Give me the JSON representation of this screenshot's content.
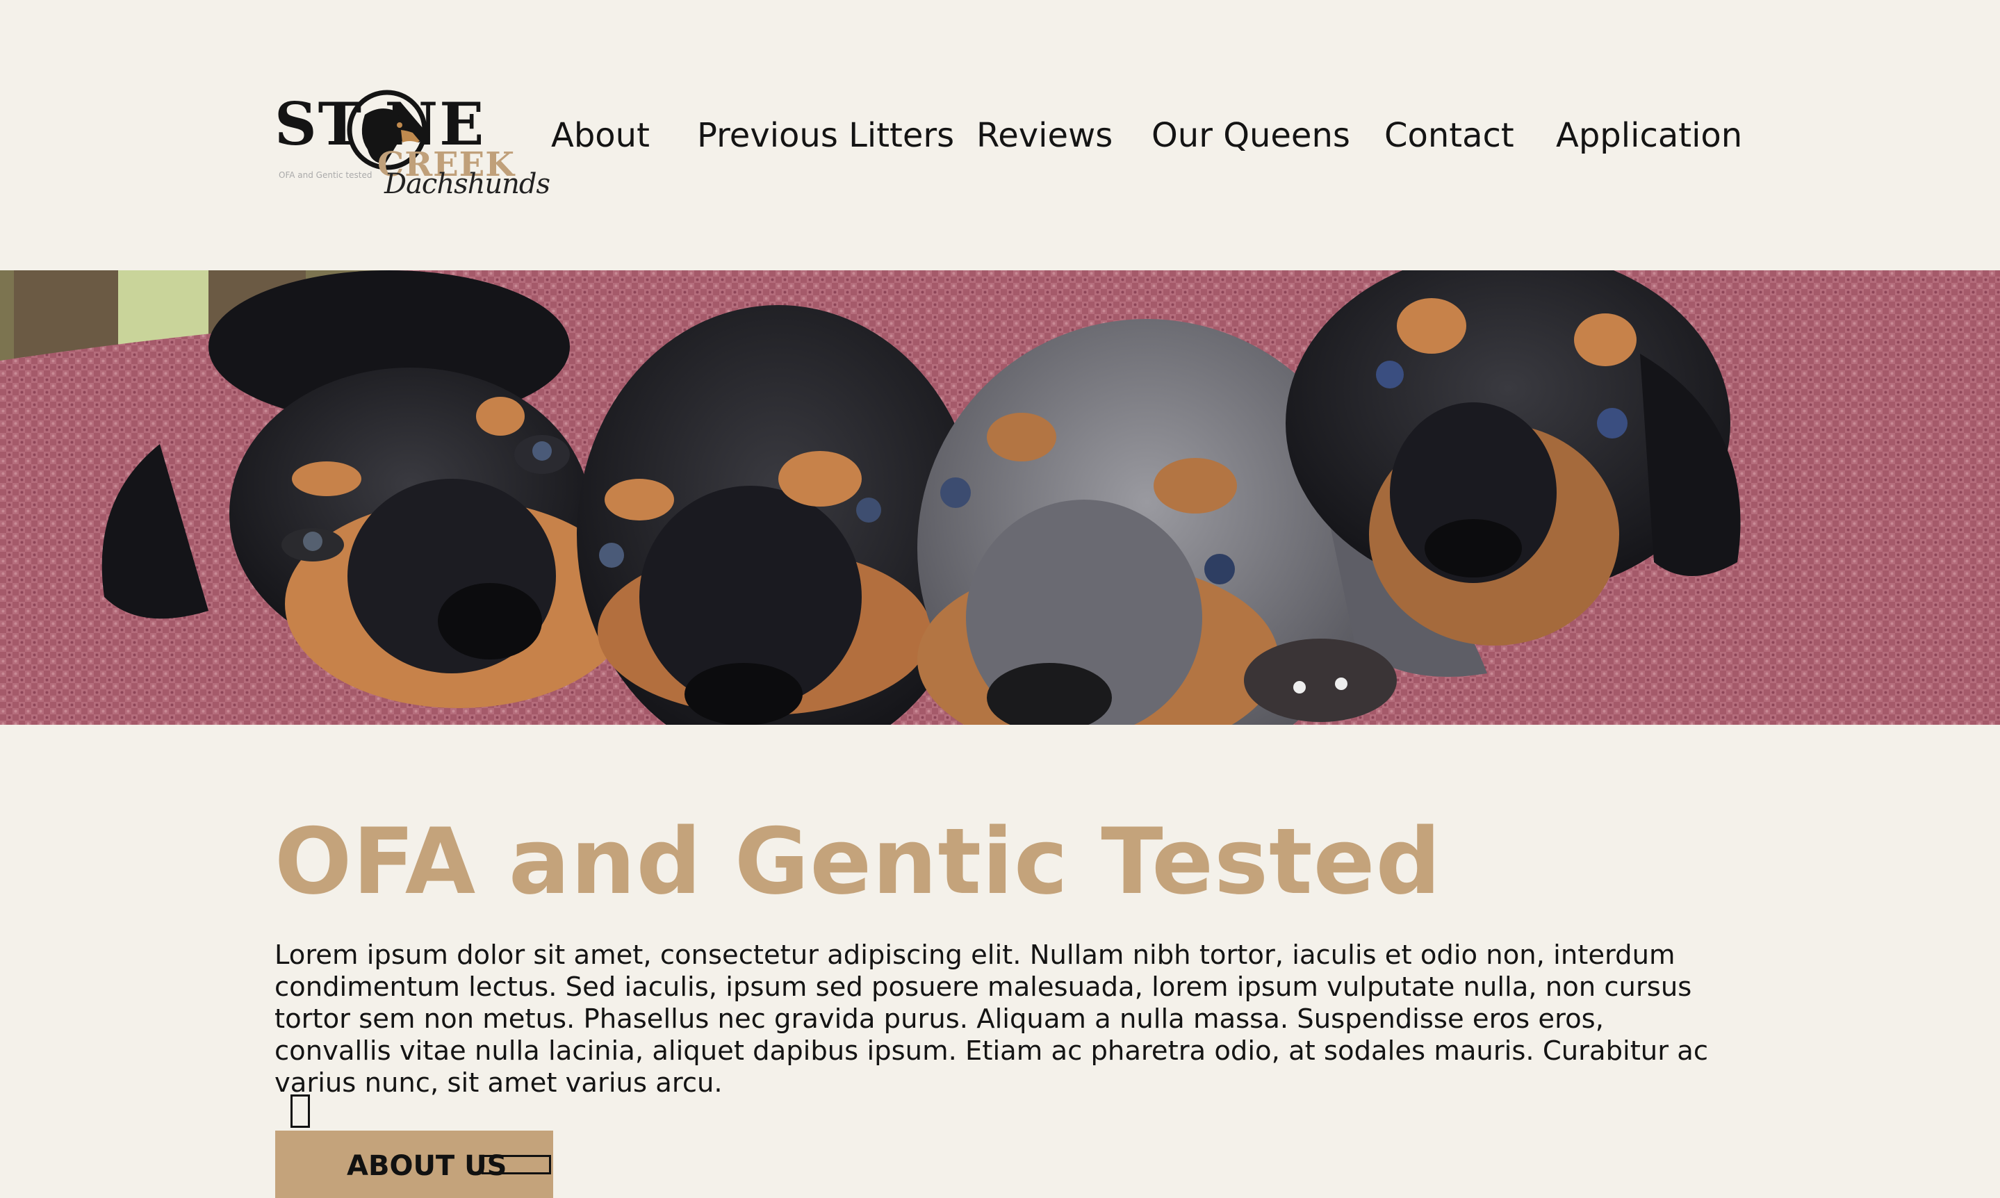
{
  "brand": {
    "name_top": "ST NE",
    "name_accent": "CREEK",
    "tagline": "OFA and Gentic tested",
    "script": "Dachshunds"
  },
  "nav": {
    "items": [
      {
        "label": "About"
      },
      {
        "label": "Previous Litters"
      },
      {
        "label": "Reviews"
      },
      {
        "label": "Our Queens"
      },
      {
        "label": "Contact"
      },
      {
        "label": "Application"
      }
    ]
  },
  "hero": {
    "icon": "dachshund-puppies-photo"
  },
  "main": {
    "title": "OFA and Gentic Tested",
    "body": "Lorem ipsum dolor sit amet, consectetur adipiscing elit. Nullam nibh tortor, iaculis et odio non, interdum condimentum lectus. Sed iaculis, ipsum sed posuere malesuada, lorem ipsum vulputate nulla, non cursus tortor sem non metus. Phasellus nec gravida purus. Aliquam a nulla massa. Suspendisse eros eros, convallis vitae nulla lacinia, aliquet dapibus ipsum. Etiam ac pharetra odio, at sodales mauris. Curabitur ac varius nunc, sit amet varius arcu.",
    "button_label": "ABOUT US"
  },
  "colors": {
    "background": "#f4f1ea",
    "accent": "#c4a37b",
    "text": "#141414"
  }
}
